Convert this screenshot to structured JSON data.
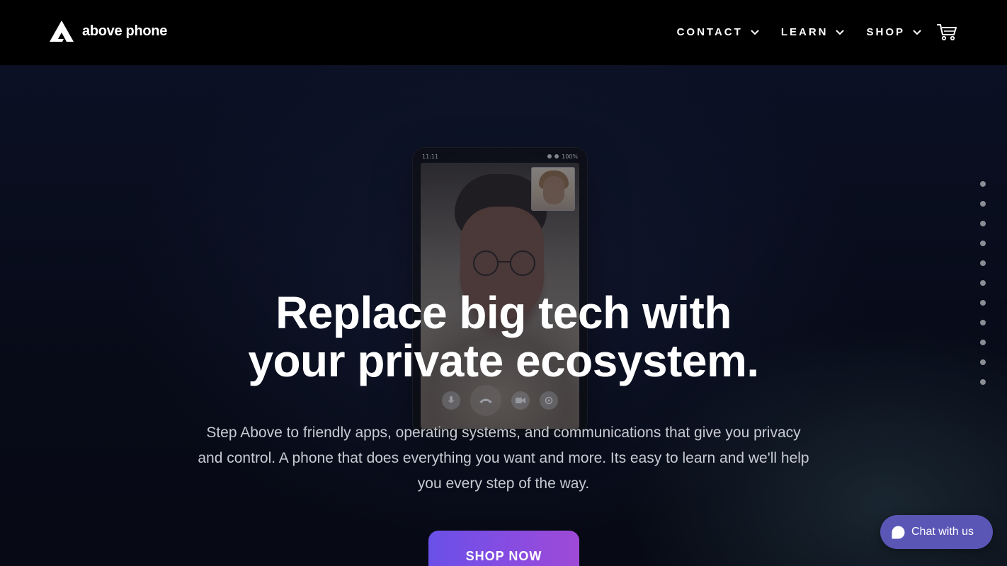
{
  "brand": {
    "name": "above phone",
    "logo_icon": "above-phone-logo-icon"
  },
  "nav": {
    "items": [
      {
        "label": "CONTACT",
        "icon": "chevron-down-icon"
      },
      {
        "label": "LEARN",
        "icon": "chevron-down-icon"
      },
      {
        "label": "SHOP",
        "icon": "chevron-down-icon"
      }
    ],
    "cart_icon": "shopping-cart-icon"
  },
  "phone": {
    "status_time": "11:11",
    "status_battery": "100%"
  },
  "hero": {
    "headline_line1": "Replace big tech with",
    "headline_line2": "your private ecosystem.",
    "subtext": "Step Above to friendly apps, operating systems, and communications that give you privacy and control. A phone that does everything you want and more. Its easy to learn and we'll help you every step of the way.",
    "cta_label": "SHOP NOW"
  },
  "section_dots": {
    "count": 11
  },
  "chat": {
    "label": "Chat with us",
    "icon": "chat-bubble-icon"
  },
  "colors": {
    "header_bg": "#000000",
    "hero_bg": "#080c1a",
    "cta_gradient_start": "#6a50e8",
    "cta_gradient_end": "#9f4ad6",
    "chat_bg": "#5a56b6"
  }
}
